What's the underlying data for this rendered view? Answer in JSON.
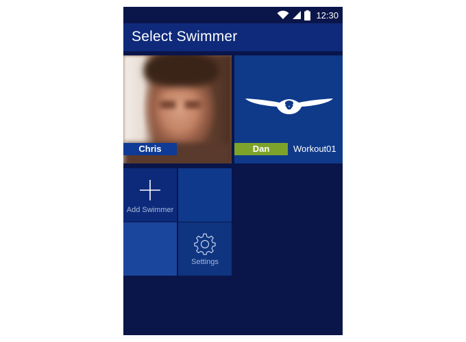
{
  "status_bar": {
    "time": "12:30",
    "icons": [
      "wifi-icon",
      "cell-signal-icon",
      "battery-icon"
    ]
  },
  "app_bar": {
    "title": "Select Swimmer"
  },
  "swimmers": [
    {
      "name": "Chris",
      "avatar": "photo",
      "label_color": "#0f3a96"
    },
    {
      "name": "Dan",
      "avatar": "swimmer-icon",
      "label_color": "#7ea32a",
      "workout": "Workout01"
    }
  ],
  "actions": {
    "add_swimmer": {
      "label": "Add Swimmer",
      "icon": "plus-icon"
    },
    "settings": {
      "label": "Settings",
      "icon": "gear-icon"
    }
  },
  "colors": {
    "background": "#0a154a",
    "app_bar": "#0f2a7a",
    "accent_green": "#7ea32a",
    "tile_blue": "#0f3a8a"
  }
}
